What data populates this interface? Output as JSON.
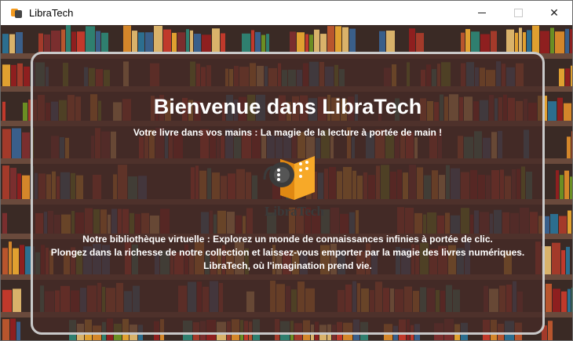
{
  "window": {
    "title": "LibraTech",
    "close_glyph": "✕"
  },
  "icons": {
    "app": "libratech-logo-icon",
    "minimize": "minimize-icon",
    "maximize": "maximize-icon",
    "close": "close-icon"
  },
  "hero": {
    "heading": "Bienvenue dans LibraTech",
    "subtitle": "Votre livre dans vos mains : La magie de la lecture à portée de main !",
    "logo_text": "LibraTech",
    "description": [
      "Notre bibliothèque virtuelle : Explorez un monde de connaissances infinies à portée de clic.",
      "Plongez dans la richesse de notre collection et laissez-vous emporter par la magie des livres numériques.",
      "LibraTech, où l'imagination prend vie."
    ]
  },
  "colors": {
    "accent": "#f39a1e",
    "panel_border": "#c9c9c9",
    "wall": "#3a2a25",
    "shelf": "#6a4a3c"
  }
}
